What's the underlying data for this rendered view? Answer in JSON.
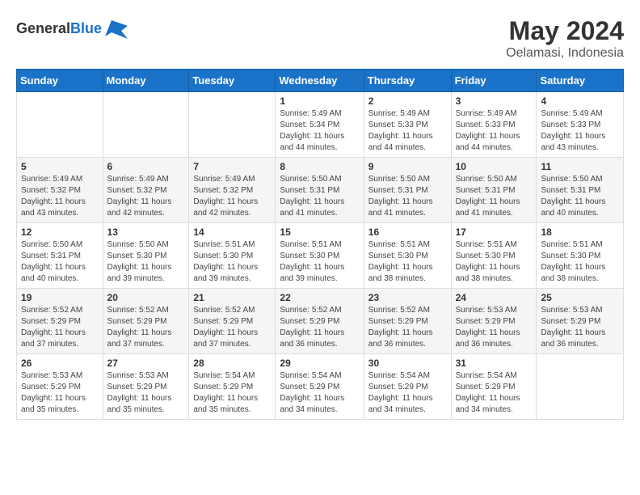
{
  "logo": {
    "general": "General",
    "blue": "Blue"
  },
  "header": {
    "title": "May 2024",
    "subtitle": "Oelamasi, Indonesia"
  },
  "weekdays": [
    "Sunday",
    "Monday",
    "Tuesday",
    "Wednesday",
    "Thursday",
    "Friday",
    "Saturday"
  ],
  "weeks": [
    [
      {
        "day": "",
        "info": ""
      },
      {
        "day": "",
        "info": ""
      },
      {
        "day": "",
        "info": ""
      },
      {
        "day": "1",
        "sunrise": "Sunrise: 5:49 AM",
        "sunset": "Sunset: 5:34 PM",
        "daylight": "Daylight: 11 hours and 44 minutes."
      },
      {
        "day": "2",
        "sunrise": "Sunrise: 5:49 AM",
        "sunset": "Sunset: 5:33 PM",
        "daylight": "Daylight: 11 hours and 44 minutes."
      },
      {
        "day": "3",
        "sunrise": "Sunrise: 5:49 AM",
        "sunset": "Sunset: 5:33 PM",
        "daylight": "Daylight: 11 hours and 44 minutes."
      },
      {
        "day": "4",
        "sunrise": "Sunrise: 5:49 AM",
        "sunset": "Sunset: 5:33 PM",
        "daylight": "Daylight: 11 hours and 43 minutes."
      }
    ],
    [
      {
        "day": "5",
        "sunrise": "Sunrise: 5:49 AM",
        "sunset": "Sunset: 5:32 PM",
        "daylight": "Daylight: 11 hours and 43 minutes."
      },
      {
        "day": "6",
        "sunrise": "Sunrise: 5:49 AM",
        "sunset": "Sunset: 5:32 PM",
        "daylight": "Daylight: 11 hours and 42 minutes."
      },
      {
        "day": "7",
        "sunrise": "Sunrise: 5:49 AM",
        "sunset": "Sunset: 5:32 PM",
        "daylight": "Daylight: 11 hours and 42 minutes."
      },
      {
        "day": "8",
        "sunrise": "Sunrise: 5:50 AM",
        "sunset": "Sunset: 5:31 PM",
        "daylight": "Daylight: 11 hours and 41 minutes."
      },
      {
        "day": "9",
        "sunrise": "Sunrise: 5:50 AM",
        "sunset": "Sunset: 5:31 PM",
        "daylight": "Daylight: 11 hours and 41 minutes."
      },
      {
        "day": "10",
        "sunrise": "Sunrise: 5:50 AM",
        "sunset": "Sunset: 5:31 PM",
        "daylight": "Daylight: 11 hours and 41 minutes."
      },
      {
        "day": "11",
        "sunrise": "Sunrise: 5:50 AM",
        "sunset": "Sunset: 5:31 PM",
        "daylight": "Daylight: 11 hours and 40 minutes."
      }
    ],
    [
      {
        "day": "12",
        "sunrise": "Sunrise: 5:50 AM",
        "sunset": "Sunset: 5:31 PM",
        "daylight": "Daylight: 11 hours and 40 minutes."
      },
      {
        "day": "13",
        "sunrise": "Sunrise: 5:50 AM",
        "sunset": "Sunset: 5:30 PM",
        "daylight": "Daylight: 11 hours and 39 minutes."
      },
      {
        "day": "14",
        "sunrise": "Sunrise: 5:51 AM",
        "sunset": "Sunset: 5:30 PM",
        "daylight": "Daylight: 11 hours and 39 minutes."
      },
      {
        "day": "15",
        "sunrise": "Sunrise: 5:51 AM",
        "sunset": "Sunset: 5:30 PM",
        "daylight": "Daylight: 11 hours and 39 minutes."
      },
      {
        "day": "16",
        "sunrise": "Sunrise: 5:51 AM",
        "sunset": "Sunset: 5:30 PM",
        "daylight": "Daylight: 11 hours and 38 minutes."
      },
      {
        "day": "17",
        "sunrise": "Sunrise: 5:51 AM",
        "sunset": "Sunset: 5:30 PM",
        "daylight": "Daylight: 11 hours and 38 minutes."
      },
      {
        "day": "18",
        "sunrise": "Sunrise: 5:51 AM",
        "sunset": "Sunset: 5:30 PM",
        "daylight": "Daylight: 11 hours and 38 minutes."
      }
    ],
    [
      {
        "day": "19",
        "sunrise": "Sunrise: 5:52 AM",
        "sunset": "Sunset: 5:29 PM",
        "daylight": "Daylight: 11 hours and 37 minutes."
      },
      {
        "day": "20",
        "sunrise": "Sunrise: 5:52 AM",
        "sunset": "Sunset: 5:29 PM",
        "daylight": "Daylight: 11 hours and 37 minutes."
      },
      {
        "day": "21",
        "sunrise": "Sunrise: 5:52 AM",
        "sunset": "Sunset: 5:29 PM",
        "daylight": "Daylight: 11 hours and 37 minutes."
      },
      {
        "day": "22",
        "sunrise": "Sunrise: 5:52 AM",
        "sunset": "Sunset: 5:29 PM",
        "daylight": "Daylight: 11 hours and 36 minutes."
      },
      {
        "day": "23",
        "sunrise": "Sunrise: 5:52 AM",
        "sunset": "Sunset: 5:29 PM",
        "daylight": "Daylight: 11 hours and 36 minutes."
      },
      {
        "day": "24",
        "sunrise": "Sunrise: 5:53 AM",
        "sunset": "Sunset: 5:29 PM",
        "daylight": "Daylight: 11 hours and 36 minutes."
      },
      {
        "day": "25",
        "sunrise": "Sunrise: 5:53 AM",
        "sunset": "Sunset: 5:29 PM",
        "daylight": "Daylight: 11 hours and 36 minutes."
      }
    ],
    [
      {
        "day": "26",
        "sunrise": "Sunrise: 5:53 AM",
        "sunset": "Sunset: 5:29 PM",
        "daylight": "Daylight: 11 hours and 35 minutes."
      },
      {
        "day": "27",
        "sunrise": "Sunrise: 5:53 AM",
        "sunset": "Sunset: 5:29 PM",
        "daylight": "Daylight: 11 hours and 35 minutes."
      },
      {
        "day": "28",
        "sunrise": "Sunrise: 5:54 AM",
        "sunset": "Sunset: 5:29 PM",
        "daylight": "Daylight: 11 hours and 35 minutes."
      },
      {
        "day": "29",
        "sunrise": "Sunrise: 5:54 AM",
        "sunset": "Sunset: 5:29 PM",
        "daylight": "Daylight: 11 hours and 34 minutes."
      },
      {
        "day": "30",
        "sunrise": "Sunrise: 5:54 AM",
        "sunset": "Sunset: 5:29 PM",
        "daylight": "Daylight: 11 hours and 34 minutes."
      },
      {
        "day": "31",
        "sunrise": "Sunrise: 5:54 AM",
        "sunset": "Sunset: 5:29 PM",
        "daylight": "Daylight: 11 hours and 34 minutes."
      },
      {
        "day": "",
        "info": ""
      }
    ]
  ]
}
